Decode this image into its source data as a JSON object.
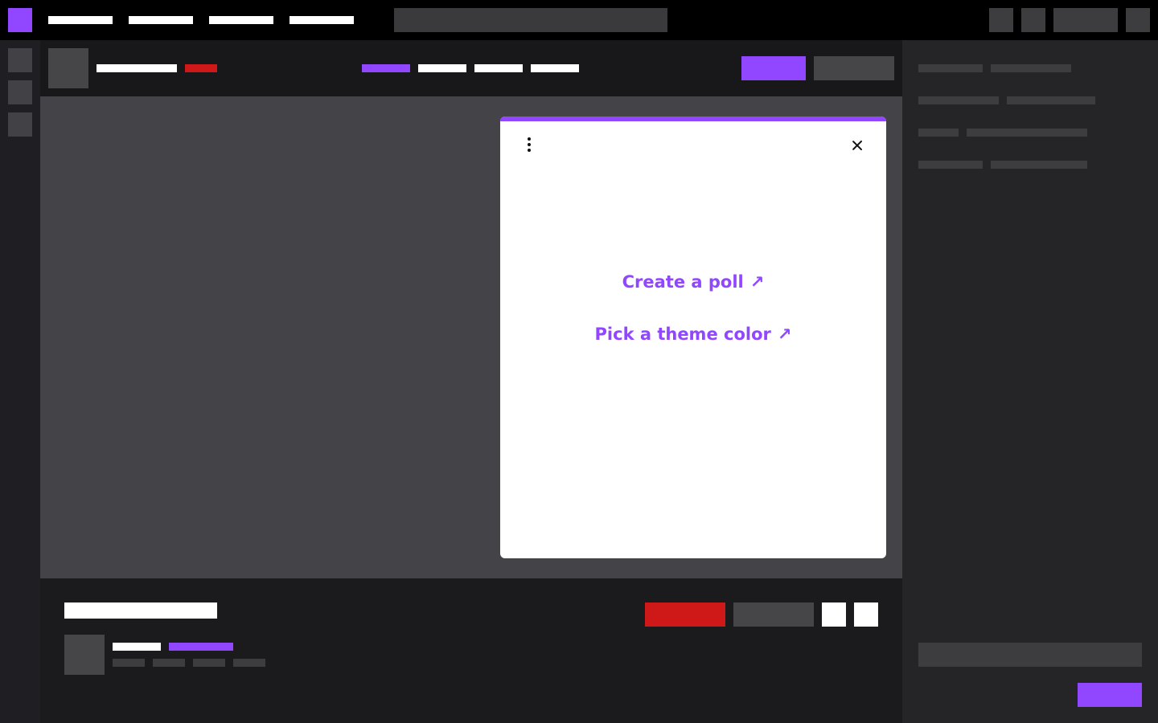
{
  "modal": {
    "links": [
      {
        "label": "Create a poll",
        "icon": "arrow-up-right-icon",
        "glyph": "↗"
      },
      {
        "label": "Pick a theme color",
        "icon": "arrow-up-right-icon",
        "glyph": "↗"
      }
    ],
    "menu_icon": "vertical-ellipsis-icon",
    "close_icon": "close-icon"
  },
  "colors": {
    "accent": "#9146ff",
    "alert": "#cf1919",
    "topbar": "#000000",
    "player": "#434348",
    "modal_bg": "#ffffff"
  }
}
